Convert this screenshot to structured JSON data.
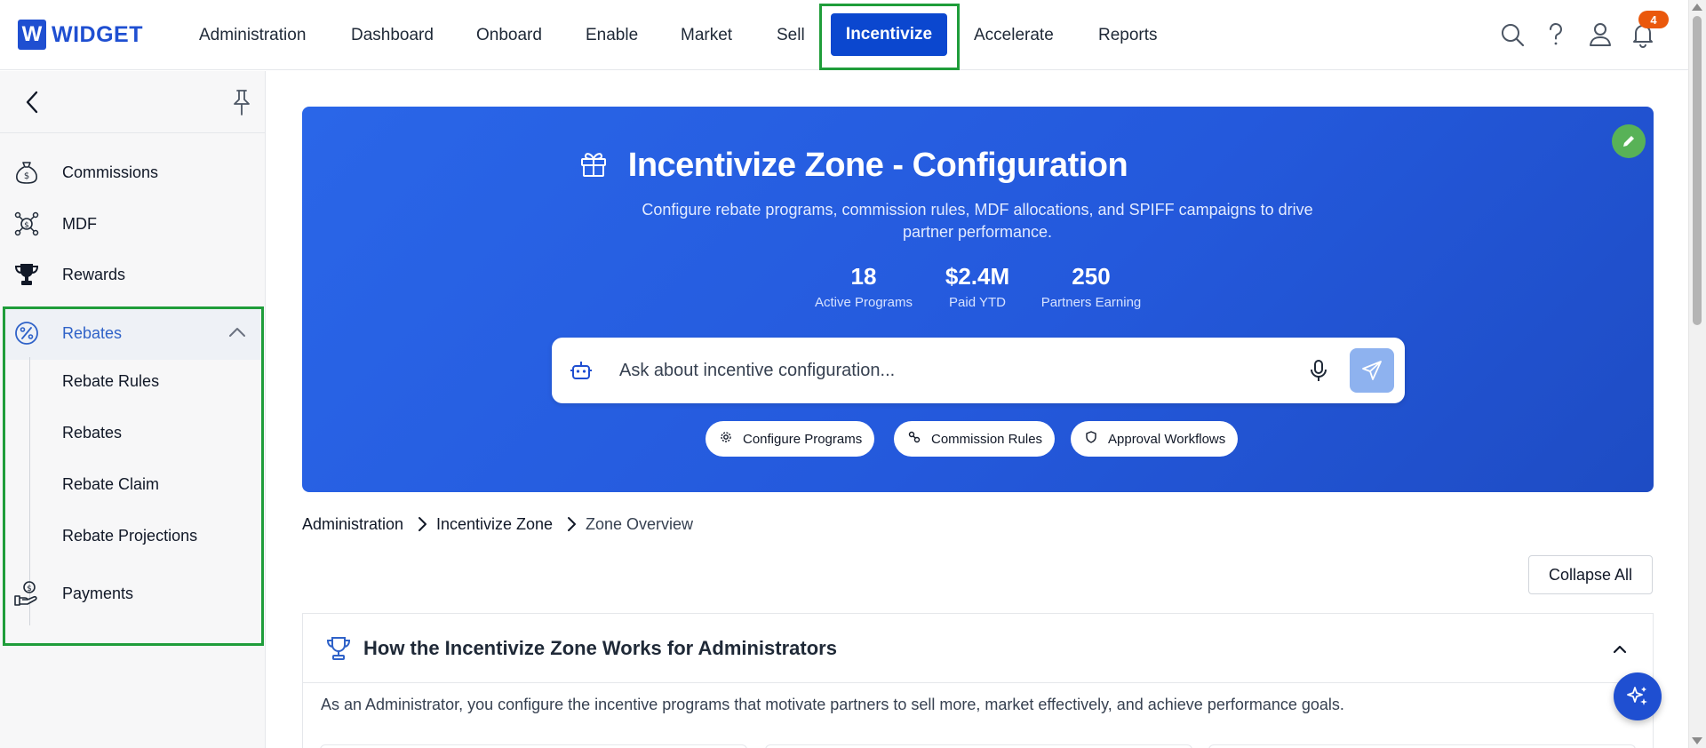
{
  "brand": {
    "logo_letter": "W",
    "name": "WIDGET",
    "color": "#1f4fd1"
  },
  "nav": {
    "items": [
      {
        "label": "Administration"
      },
      {
        "label": "Dashboard"
      },
      {
        "label": "Onboard"
      },
      {
        "label": "Enable"
      },
      {
        "label": "Market"
      },
      {
        "label": "Sell"
      },
      {
        "label": "Incentivize",
        "active": true
      },
      {
        "label": "Accelerate"
      },
      {
        "label": "Reports"
      }
    ],
    "icons": [
      "search-icon",
      "help-icon",
      "user-icon",
      "bell-icon"
    ],
    "notification_count": "4",
    "accent": "#0b47cf",
    "highlight": "#1f9d3a"
  },
  "sidebar": {
    "items": [
      {
        "label": "Commissions",
        "icon": "money-bag-icon"
      },
      {
        "label": "MDF",
        "icon": "dollar-network-icon"
      },
      {
        "label": "Rewards",
        "icon": "trophy-icon"
      },
      {
        "label": "Rebates",
        "icon": "percent-icon",
        "active": true,
        "expanded": true
      },
      {
        "label": "Payments",
        "icon": "hand-coin-icon"
      }
    ],
    "rebates_sub": [
      {
        "label": "Rebate Rules"
      },
      {
        "label": "Rebates"
      },
      {
        "label": "Rebate Claim"
      },
      {
        "label": "Rebate Projections"
      }
    ]
  },
  "hero": {
    "title": "Incentivize Zone - Configuration",
    "subtitle": "Configure rebate programs, commission rules, MDF allocations, and SPIFF campaigns to drive partner performance.",
    "stats": [
      {
        "value": "18",
        "label": "Active Programs"
      },
      {
        "value": "$2.4M",
        "label": "Paid YTD"
      },
      {
        "value": "250",
        "label": "Partners Earning"
      }
    ],
    "ask_placeholder": "Ask about incentive configuration...",
    "chips": [
      {
        "label": "Configure Programs",
        "icon": "gear-icon"
      },
      {
        "label": "Commission Rules",
        "icon": "link-icon"
      },
      {
        "label": "Approval Workflows",
        "icon": "shield-icon"
      }
    ]
  },
  "breadcrumb": [
    "Administration",
    "Incentivize Zone",
    "Zone Overview"
  ],
  "collapse_all_label": "Collapse All",
  "section": {
    "title": "How the Incentivize Zone Works for Administrators",
    "description": "As an Administrator, you configure the incentive programs that motivate partners to sell more, market effectively, and achieve performance goals."
  }
}
